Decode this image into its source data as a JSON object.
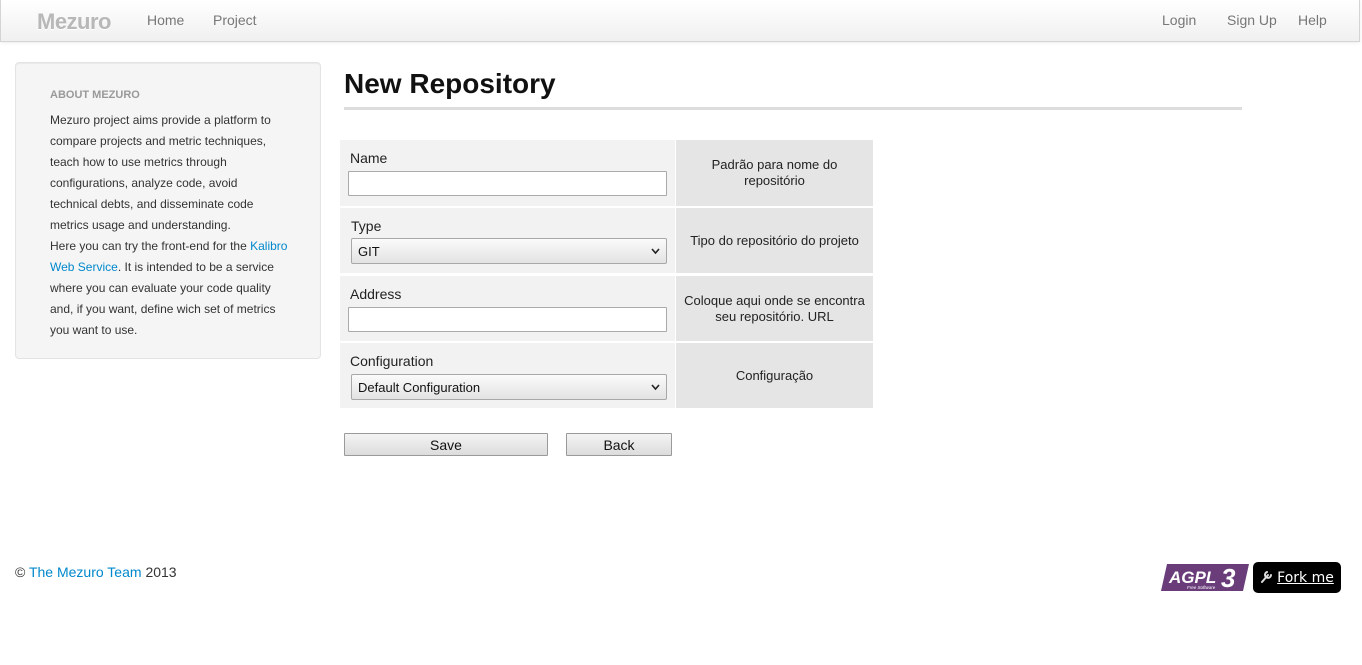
{
  "navbar": {
    "brand": "Mezuro",
    "left_links": [
      "Home",
      "Project"
    ],
    "right_links": [
      "Login",
      "Sign Up",
      "Help"
    ]
  },
  "sidebar": {
    "header": "ABOUT MEZURO",
    "paragraph1": "Mezuro project aims provide a platform to compare projects and metric techniques, teach how to use metrics through configurations, analyze code, avoid technical debts, and disseminate code metrics usage and understanding.",
    "paragraph2_before": "Here you can try the front-end for the ",
    "paragraph2_link": "Kalibro Web Service",
    "paragraph2_after": ". It is intended to be a service where you can evaluate your code quality and, if you want, define wich set of metrics you want to use."
  },
  "page": {
    "title": "New Repository"
  },
  "form": {
    "name": {
      "label": "Name",
      "value": "",
      "help": "Padrão para nome do repositório"
    },
    "type": {
      "label": "Type",
      "value": "GIT",
      "help": "Tipo do repositório do projeto"
    },
    "address": {
      "label": "Address",
      "value": "",
      "help": "Coloque aqui onde se encontra seu repositório. URL"
    },
    "configuration": {
      "label": "Configuration",
      "value": "Default Configuration",
      "help": "Configuração"
    },
    "save_label": "Save",
    "back_label": "Back"
  },
  "footer": {
    "copyright_symbol": "©",
    "team_link": "The Mezuro Team",
    "year": "2013",
    "agpl_text": "AGPL",
    "agpl_version": "3",
    "agpl_subtext": "Free Software",
    "fork_label": "Fork me"
  },
  "icons": {
    "brand_icon": "mezuro-logo-icon",
    "select_arrow": "chevron-down-icon",
    "fork_icon": "wrench-icon"
  },
  "colors": {
    "link": "#0088cc",
    "agpl_purple": "#6a3d7a"
  }
}
